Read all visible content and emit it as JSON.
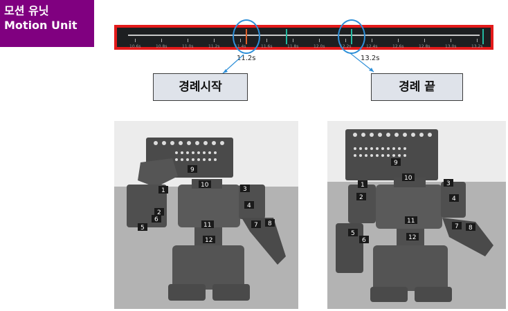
{
  "title_box": {
    "line1": "모션 유닛",
    "line2": "Motion Unit"
  },
  "timeline": {
    "tick_labels": [
      "10.6s",
      "10.8s",
      "11.0s",
      "11.2s",
      "11.4s",
      "11.6s",
      "11.8s",
      "12.0s",
      "12.2s",
      "12.4s",
      "12.6s",
      "12.8s",
      "13.0s",
      "13.2s"
    ],
    "marker_colors": {
      "start": "#e0602a",
      "mid": "#22b8a0",
      "end": "#22b8a0"
    }
  },
  "annotations": {
    "start_time": "11.2s",
    "end_time": "13.2s",
    "start_label": "경례시작",
    "end_label": "경례 끝",
    "accent": "#2e8fd8"
  },
  "robot_left": {
    "joint_labels": [
      "1",
      "2",
      "3",
      "4",
      "5",
      "6",
      "7",
      "8",
      "9",
      "10",
      "11",
      "12"
    ]
  },
  "robot_right": {
    "joint_labels": [
      "1",
      "2",
      "3",
      "4",
      "5",
      "6",
      "7",
      "8",
      "9",
      "10",
      "11",
      "12"
    ]
  }
}
